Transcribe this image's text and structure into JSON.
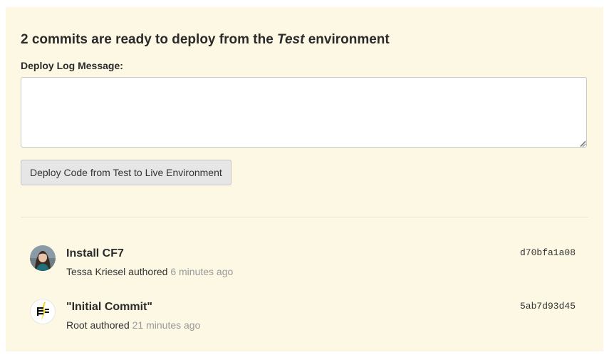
{
  "deploy": {
    "heading_prefix": "2 commits are ready to deploy from the ",
    "heading_env": "Test",
    "heading_suffix": " environment",
    "message_label": "Deploy Log Message:",
    "message_value": "",
    "button_label": "Deploy Code from Test to Live Environment"
  },
  "commits": [
    {
      "title": "Install CF7",
      "author": "Tessa Kriesel",
      "authored_word": " authored ",
      "time": "6 minutes ago",
      "hash": "d70bfa1a08",
      "avatar": "user-photo-avatar"
    },
    {
      "title": "\"Initial Commit\"",
      "author": "Root",
      "authored_word": " authored ",
      "time": "21 minutes ago",
      "hash": "5ab7d93d45",
      "avatar": "pantheon-logo-avatar"
    }
  ],
  "colors": {
    "panel_bg": "#fcf8e3",
    "button_bg": "#e6e6e6",
    "muted_text": "#999999"
  }
}
